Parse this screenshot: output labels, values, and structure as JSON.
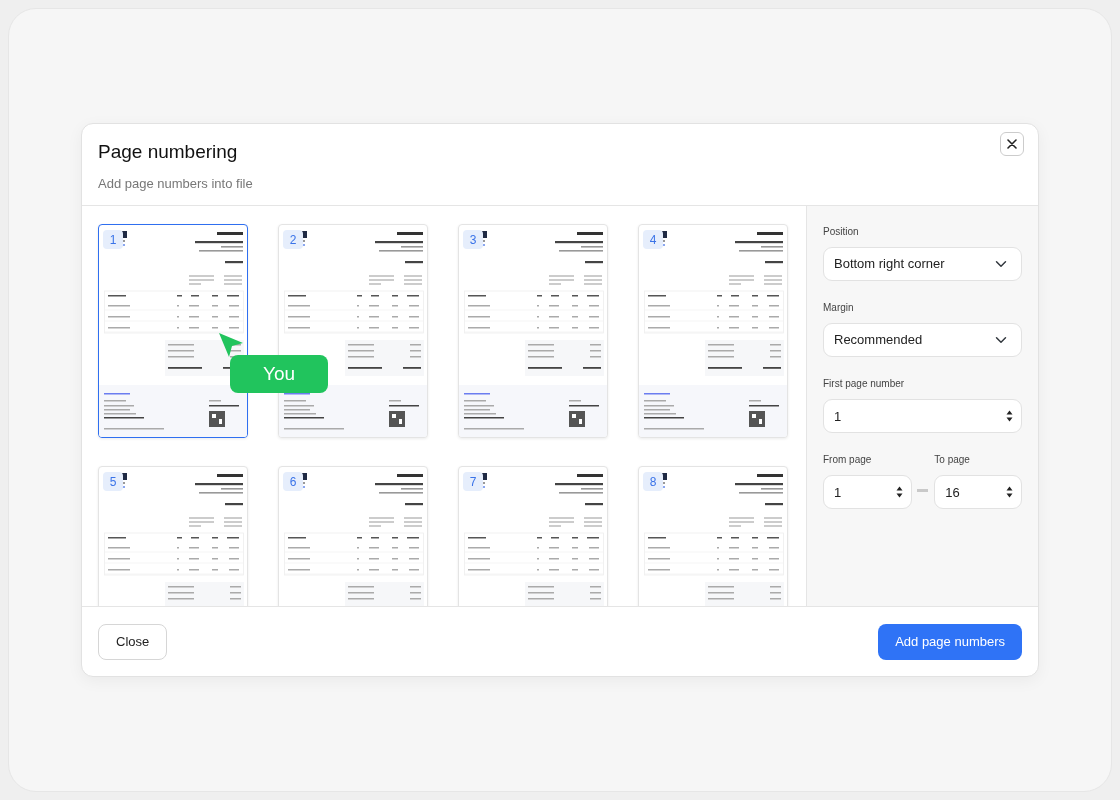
{
  "dialog": {
    "title": "Page numbering",
    "subtitle": "Add page numbers into file"
  },
  "pages": [
    {
      "number": "1",
      "selected": true
    },
    {
      "number": "2",
      "selected": false
    },
    {
      "number": "3",
      "selected": false
    },
    {
      "number": "4",
      "selected": false
    },
    {
      "number": "5",
      "selected": false
    },
    {
      "number": "6",
      "selected": false
    },
    {
      "number": "7",
      "selected": false
    },
    {
      "number": "8",
      "selected": false
    }
  ],
  "cursor": {
    "label": "You"
  },
  "settings": {
    "position": {
      "label": "Position",
      "value": "Bottom right corner"
    },
    "margin": {
      "label": "Margin",
      "value": "Recommended"
    },
    "first_page": {
      "label": "First page number",
      "value": "1"
    },
    "from_page": {
      "label": "From page",
      "value": "1"
    },
    "to_page": {
      "label": "To page",
      "value": "16"
    }
  },
  "footer": {
    "close": "Close",
    "submit": "Add page numbers"
  }
}
